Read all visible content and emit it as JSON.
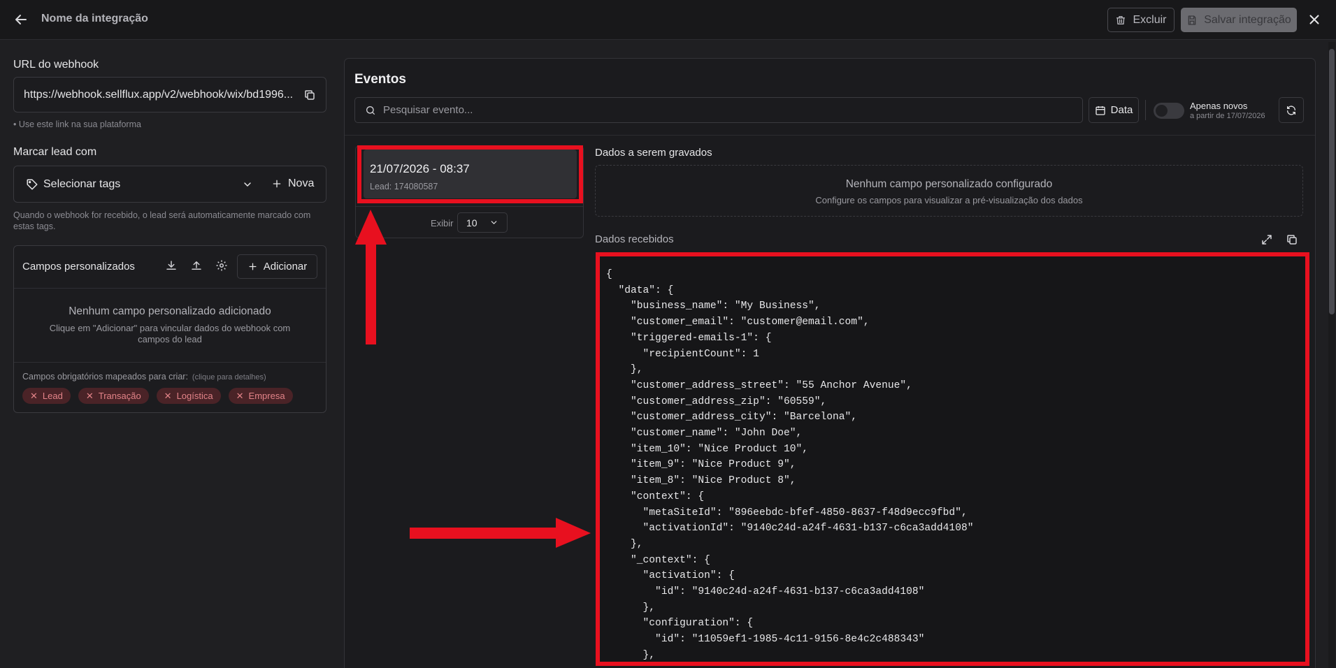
{
  "header": {
    "title": "Nome da integração",
    "delete_label": "Excluir",
    "save_label": "Salvar integração"
  },
  "left": {
    "webhook_label": "URL do webhook",
    "webhook_url": "https://webhook.sellflux.app/v2/webhook/wix/bd1996...",
    "webhook_hint": "• Use este link na sua plataforma",
    "mark_lead_label": "Marcar lead com",
    "select_tags_label": "Selecionar tags",
    "new_tag_label": "Nova",
    "tags_hint": "Quando o webhook for recebido, o lead será automaticamente marcado com estas tags.",
    "custom_fields": {
      "title": "Campos personalizados",
      "add_label": "Adicionar",
      "empty_title": "Nenhum campo personalizado adicionado",
      "empty_desc": "Clique em \"Adicionar\" para vincular dados do webhook com campos do lead",
      "required_label": "Campos obrigatórios mapeados para criar:",
      "required_hint": "(clique para detalhes)",
      "required_pills": [
        "Lead",
        "Transação",
        "Logística",
        "Empresa"
      ]
    }
  },
  "events": {
    "title": "Eventos",
    "search_placeholder": "Pesquisar evento...",
    "date_button": "Data",
    "only_new_label": "Apenas novos",
    "only_new_sub": "a partir de 17/07/2026",
    "only_new_enabled": false,
    "list": [
      {
        "datetime": "21/07/2026 - 08:37",
        "lead": "Lead: 174080587"
      }
    ],
    "show_label": "Exibir",
    "show_value": "10"
  },
  "details": {
    "saved_title": "Dados a serem gravados",
    "saved_empty_title": "Nenhum campo personalizado configurado",
    "saved_empty_desc": "Configure os campos para visualizar a pré-visualização dos dados",
    "received_title": "Dados recebidos",
    "json_text": "{\n  \"data\": {\n    \"business_name\": \"My Business\",\n    \"customer_email\": \"customer@email.com\",\n    \"triggered-emails-1\": {\n      \"recipientCount\": 1\n    },\n    \"customer_address_street\": \"55 Anchor Avenue\",\n    \"customer_address_zip\": \"60559\",\n    \"customer_address_city\": \"Barcelona\",\n    \"customer_name\": \"John Doe\",\n    \"item_10\": \"Nice Product 10\",\n    \"item_9\": \"Nice Product 9\",\n    \"item_8\": \"Nice Product 8\",\n    \"context\": {\n      \"metaSiteId\": \"896eebdc-bfef-4850-8637-f48d9ecc9fbd\",\n      \"activationId\": \"9140c24d-a24f-4631-b137-c6ca3add4108\"\n    },\n    \"_context\": {\n      \"activation\": {\n        \"id\": \"9140c24d-a24f-4631-b137-c6ca3add4108\"\n      },\n      \"configuration\": {\n        \"id\": \"11059ef1-1985-4c11-9156-8e4c2c488343\"\n      },"
  },
  "colors": {
    "annotation_red": "#e8101f",
    "pill_bg": "#4a2327",
    "pill_text": "#e28388"
  }
}
